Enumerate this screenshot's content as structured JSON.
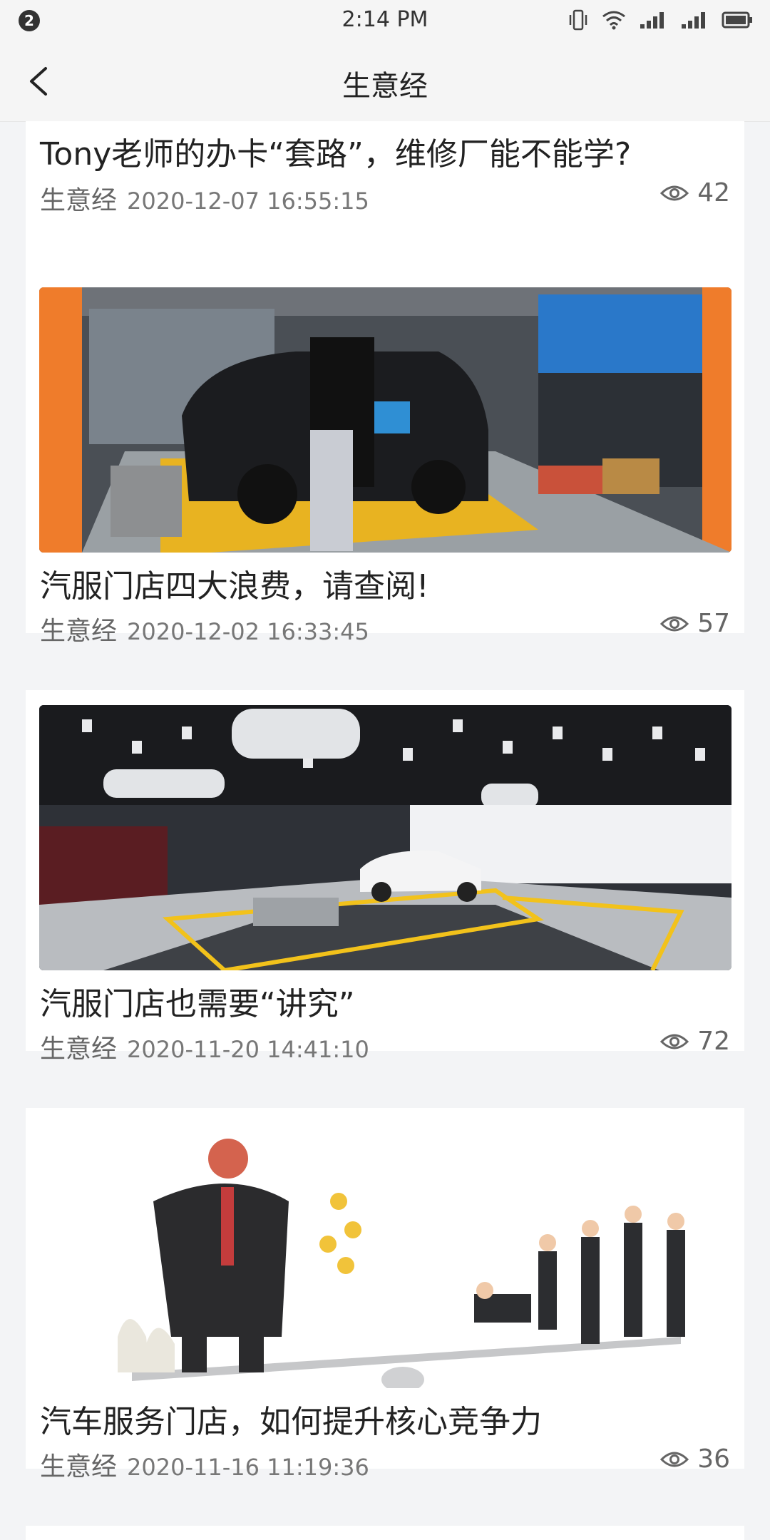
{
  "status_bar": {
    "notification_count": "2",
    "time": "2:14 PM"
  },
  "header": {
    "title": "生意经"
  },
  "articles": [
    {
      "title": "Tony老师的办卡“套路”，维修厂能不能学?",
      "source": "生意经",
      "date": "2020-12-07 16:55:15",
      "views": "42"
    },
    {
      "title": "汽服门店四大浪费，请查阅!",
      "source": "生意经",
      "date": "2020-12-02 16:33:45",
      "views": "57"
    },
    {
      "title": "汽服门店也需要“讲究”",
      "source": "生意经",
      "date": "2020-11-20 14:41:10",
      "views": "72"
    },
    {
      "title": "汽车服务门店，如何提升核心竞争力",
      "source": "生意经",
      "date": "2020-11-16 11:19:36",
      "views": "36"
    }
  ],
  "colors": {
    "background": "#f3f4f6",
    "card": "#ffffff",
    "text_primary": "#222222",
    "text_secondary": "#777777"
  }
}
